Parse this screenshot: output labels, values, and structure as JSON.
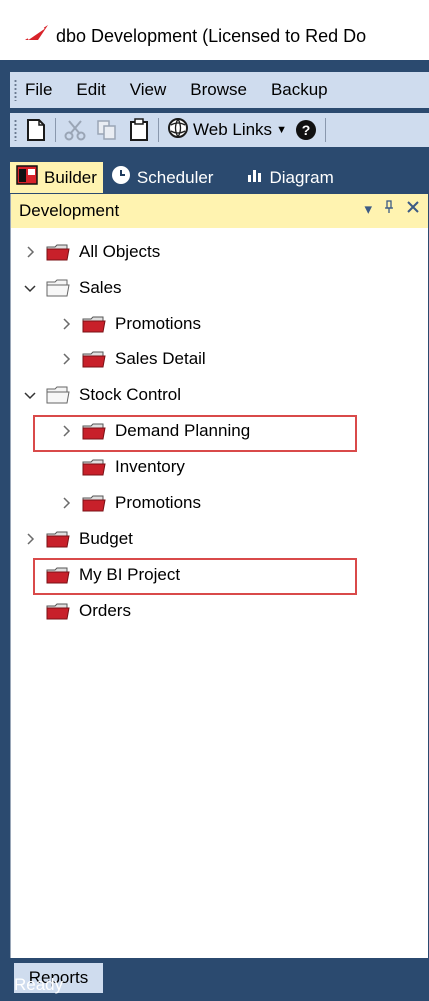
{
  "window": {
    "title": "dbo  Development  (Licensed to Red Do"
  },
  "menu": [
    "File",
    "Edit",
    "View",
    "Browse",
    "Backup"
  ],
  "toolbar": {
    "web_links_label": "Web Links",
    "icons": [
      "new-icon",
      "cut-icon",
      "copy-icon",
      "paste-icon",
      "globe-icon",
      "help-icon"
    ]
  },
  "tabs": [
    {
      "label": "Builder",
      "icon": "builder-icon",
      "active": true
    },
    {
      "label": "Scheduler",
      "icon": "clock-icon",
      "active": false
    },
    {
      "label": "Diagram",
      "icon": "diagram-icon",
      "active": false
    }
  ],
  "panel": {
    "title": "Development",
    "tree": [
      {
        "label": "All Objects",
        "level": 0,
        "expander": "collapsed",
        "icon": "red-folder"
      },
      {
        "label": "Sales",
        "level": 0,
        "expander": "expanded",
        "icon": "gray-folder"
      },
      {
        "label": "Promotions",
        "level": 1,
        "expander": "collapsed",
        "icon": "red-folder"
      },
      {
        "label": "Sales Detail",
        "level": 1,
        "expander": "collapsed",
        "icon": "red-folder"
      },
      {
        "label": "Stock Control",
        "level": 0,
        "expander": "expanded",
        "icon": "gray-folder"
      },
      {
        "label": "Demand Planning",
        "level": 1,
        "expander": "collapsed",
        "icon": "red-folder",
        "highlighted": true
      },
      {
        "label": "Inventory",
        "level": 1,
        "expander": "none",
        "icon": "red-folder"
      },
      {
        "label": "Promotions",
        "level": 1,
        "expander": "collapsed",
        "icon": "red-folder"
      },
      {
        "label": "Budget",
        "level": 0,
        "expander": "collapsed",
        "icon": "red-folder"
      },
      {
        "label": "My BI Project",
        "level": 0,
        "expander": "none",
        "icon": "red-folder",
        "highlighted": true
      },
      {
        "label": "Orders",
        "level": 0,
        "expander": "none",
        "icon": "red-folder"
      }
    ]
  },
  "bottom_tab": {
    "label": "Reports"
  },
  "status": {
    "text": "Ready"
  },
  "colors": {
    "frame": "#2b4a6f",
    "menu_bg": "#cfdcee",
    "active_tab": "#fff3b0",
    "highlight_border": "#d94a4a",
    "folder_red": "#c8202a"
  }
}
